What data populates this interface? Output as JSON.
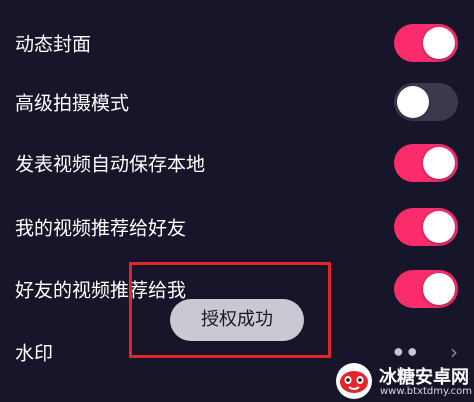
{
  "settings": [
    {
      "label": "动态封面",
      "toggle_on": true
    },
    {
      "label": "高级拍摄模式",
      "toggle_on": false
    },
    {
      "label": "发表视频自动保存本地",
      "toggle_on": true
    },
    {
      "label": "我的视频推荐给好友",
      "toggle_on": true
    },
    {
      "label": "好友的视频推荐给我",
      "toggle_on": true
    }
  ],
  "watermark_row": {
    "label": "水印",
    "arrow": "›",
    "value_icon": "dots-icon"
  },
  "toast": {
    "message": "授权成功"
  },
  "site_watermark": {
    "title": "冰糖安卓网",
    "url": "www.btxtdmy.com"
  },
  "colors": {
    "background": "#17152a",
    "toggle_on": "#fb2c6c",
    "toggle_off": "#3b3a4c",
    "highlight": "#e0262a"
  }
}
